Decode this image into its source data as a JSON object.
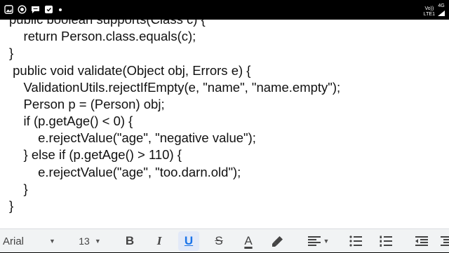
{
  "status_bar": {
    "icons": [
      "gallery-icon",
      "record-icon",
      "chat-icon",
      "notification-icon",
      "dots-icon"
    ],
    "network_line1": "Vo))",
    "network_line2": "LTE1",
    "network_type": "4G"
  },
  "document": {
    "lines": [
      "public boolean supports(Class c) {",
      "    return Person.class.equals(c);",
      "}",
      " public void validate(Object obj, Errors e) {",
      "    ValidationUtils.rejectIfEmpty(e, \"name\", \"name.empty\");",
      "    Person p = (Person) obj;",
      "    if (p.getAge() < 0) {",
      "        e.rejectValue(\"age\", \"negative value\");",
      "    } else if (p.getAge() > 110) {",
      "        e.rejectValue(\"age\", \"too.darn.old\");",
      "    }",
      "}"
    ]
  },
  "toolbar": {
    "font_family": "Arial",
    "font_size": "13",
    "bold": "B",
    "italic": "I",
    "underline": "U",
    "underline_active": true,
    "strikethrough": "S",
    "text_color": "A",
    "colors": {
      "text_color_bar": "#000000",
      "active_bg": "#e2e9f8",
      "active_fg": "#1a73e8"
    }
  }
}
